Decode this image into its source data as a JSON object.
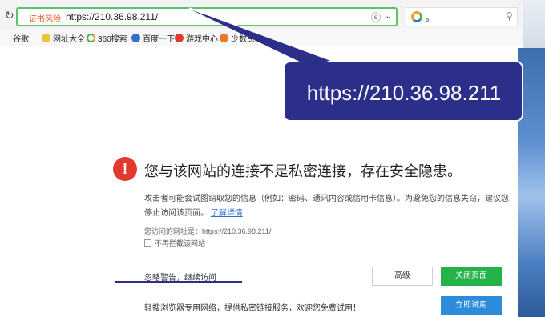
{
  "toolbar": {
    "refresh_icon": "refresh-icon",
    "cert_label": "证书风险",
    "url": "https://210.36.98.211/",
    "search_placeholder": "。",
    "search_icon": "search-icon"
  },
  "bookmarks": [
    {
      "label": "谷歌",
      "icon": "page-icon"
    },
    {
      "label": "网址大全",
      "icon": "star-icon"
    },
    {
      "label": "360搜索",
      "icon": "360-icon"
    },
    {
      "label": "百度一下",
      "icon": "paw-icon"
    },
    {
      "label": "游戏中心",
      "icon": "game-icon"
    },
    {
      "label": "少数民族",
      "icon": "globe-icon"
    }
  ],
  "warning": {
    "headline": "您与该网站的连接不是私密连接，存在安全隐患。",
    "description": "攻击者可能会试图窃取您的信息（例如：密码、通讯内容或信用卡信息）。为避免您的信息失窃，建议您停止访问该页面。",
    "learn_more": "了解详情",
    "visited_url": "您访问的网址是：https://210.36.98.211/",
    "checkbox_label": "不再拦截该网站",
    "ignore_link": "忽略警告，继续访问",
    "advanced_button": "高级",
    "close_button": "关闭页面",
    "promo_text": "轻搜浏览器专用网络，提供私密链接服务，欢迎您免费试用！",
    "try_button": "立即试用"
  },
  "callout": {
    "text": "https://210.36.98.211",
    "color": "#2c2f8a"
  },
  "colors": {
    "address_border": "#5ac36a",
    "close_button": "#26b24a",
    "try_button": "#2d8bdc",
    "warning_icon": "#e23a2e"
  }
}
